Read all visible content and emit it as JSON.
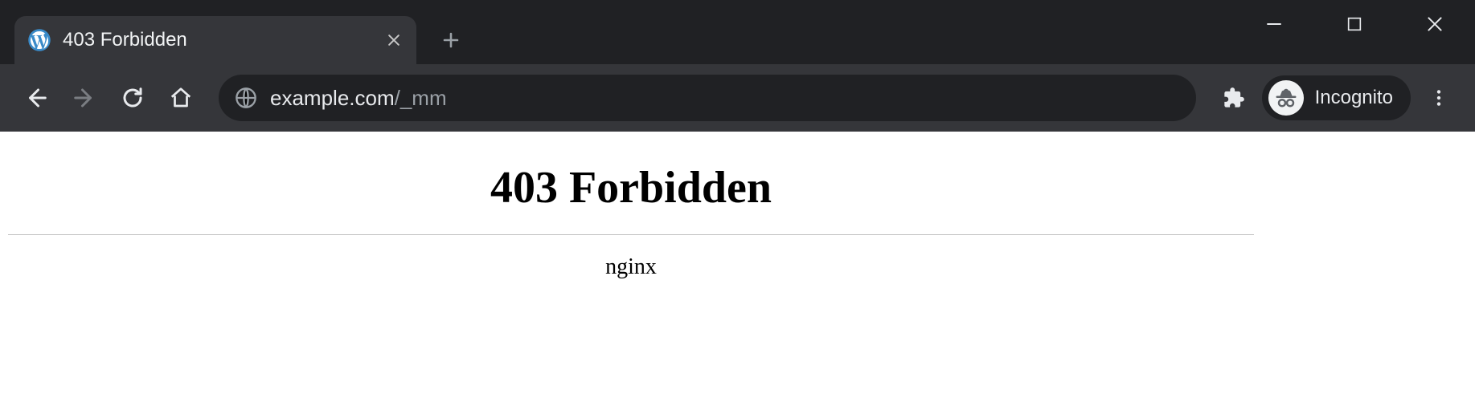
{
  "tab": {
    "title": "403 Forbidden",
    "favicon": "wordpress"
  },
  "toolbar": {
    "url_host": "example.com",
    "url_path": "/_mm",
    "incognito_label": "Incognito"
  },
  "page": {
    "heading": "403 Forbidden",
    "server": "nginx"
  }
}
